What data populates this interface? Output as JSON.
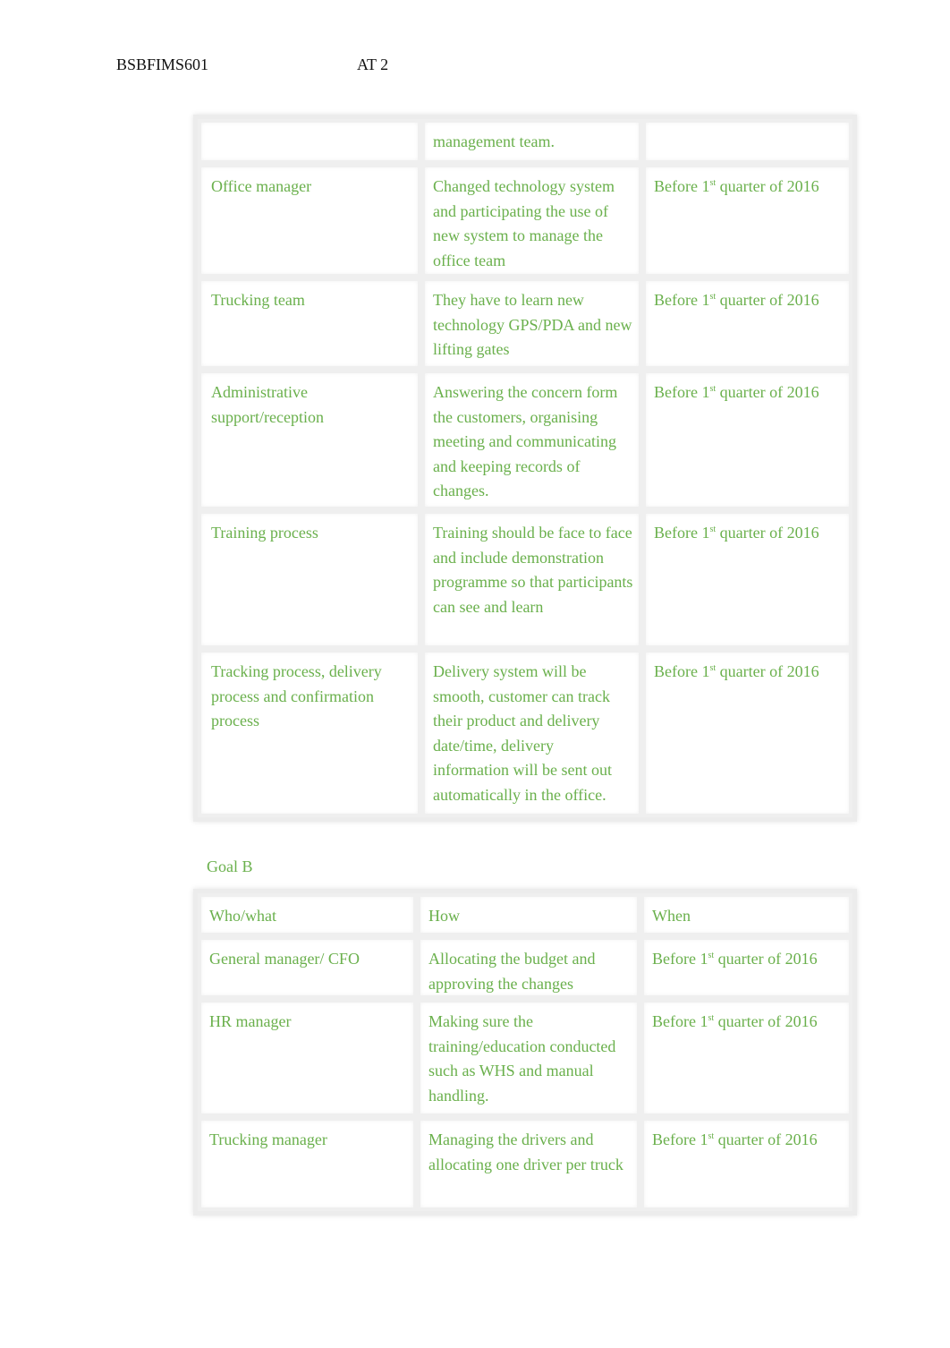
{
  "header": {
    "code": "BSBFIMS601",
    "assessment": "AT 2"
  },
  "when_text": {
    "prefix": "Before 1",
    "sup": "st",
    "suffix": " quarter of 2016"
  },
  "table_a": {
    "rows": [
      {
        "who": "",
        "how": "management team.",
        "when": ""
      },
      {
        "who": "Office manager",
        "how": "Changed technology system and participating the use of new system to manage the office team",
        "when": "yes"
      },
      {
        "who": "Trucking team",
        "how": "They have to learn new technology GPS/PDA and new lifting gates",
        "when": "yes"
      },
      {
        "who": "Administrative support/reception",
        "how": "Answering the concern form the customers, organising meeting and communicating and keeping records of changes.",
        "when": "yes"
      },
      {
        "who": "Training process",
        "how": "Training should be face to face and include demonstration programme so that participants can see and learn",
        "when": "yes"
      },
      {
        "who": "Tracking process, delivery process and confirmation process",
        "how": "Delivery system will be smooth, customer can track their product and delivery date/time, delivery information will be sent out automatically in the office.",
        "when": "yes"
      }
    ]
  },
  "goal_b": {
    "title": "Goal B",
    "headers": [
      "Who/what",
      "How",
      "When"
    ],
    "rows": [
      {
        "who": "General manager/ CFO",
        "how": "Allocating the budget and approving the changes"
      },
      {
        "who": "HR manager",
        "how": "Making sure the training/education conducted such as WHS and manual handling."
      },
      {
        "who": "Trucking manager",
        "how": "Managing the drivers and allocating one driver per truck"
      }
    ]
  }
}
